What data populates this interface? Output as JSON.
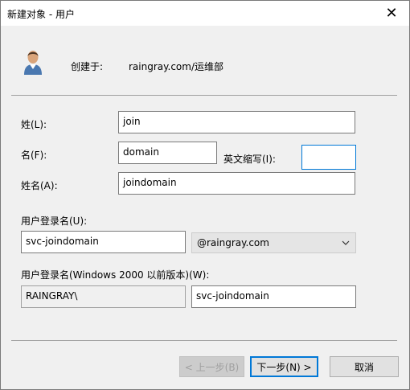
{
  "window": {
    "title": "新建对象 - 用户",
    "close_glyph": "✕"
  },
  "header": {
    "created_in_label": "创建于:",
    "created_in_value": "raingray.com/运维部"
  },
  "form": {
    "last_name": {
      "label": "姓(L):",
      "value": "join"
    },
    "first_name": {
      "label": "名(F):",
      "value": "domain"
    },
    "initials": {
      "label": "英文缩写(I):",
      "value": ""
    },
    "full_name": {
      "label": "姓名(A):",
      "value": "joindomain"
    },
    "logon_name": {
      "label": "用户登录名(U):",
      "value": "svc-joindomain"
    },
    "upn_suffix": {
      "value": "@raingray.com"
    },
    "pre2000_logon": {
      "label": "用户登录名(Windows 2000 以前版本)(W):",
      "domain": "RAINGRAY\\",
      "value": "svc-joindomain"
    }
  },
  "buttons": {
    "back": "< 上一步(B)",
    "next": "下一步(N) >",
    "cancel": "取消"
  }
}
